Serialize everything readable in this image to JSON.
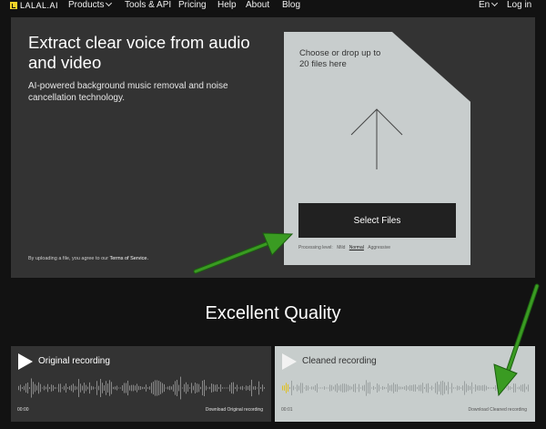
{
  "nav": {
    "logo_text": "LALAL.AI",
    "items": [
      {
        "label": "Products",
        "dropdown": true
      },
      {
        "label": "Tools & API"
      },
      {
        "label": "Pricing"
      },
      {
        "label": "Help"
      },
      {
        "label": "About"
      },
      {
        "label": "Blog"
      }
    ],
    "language": "En",
    "login": "Log in"
  },
  "hero": {
    "title": "Extract clear voice from audio and video",
    "subtitle": "AI-powered background music removal and noise cancellation technology.",
    "terms_prefix": "By uploading a file, you agree to our",
    "terms_link": "Terms of Service."
  },
  "dropzone": {
    "text": "Choose or drop up to 20 files here",
    "button": "Select Files",
    "level_label": "Processing level:",
    "levels": [
      "Mild",
      "Normal",
      "Aggressive"
    ],
    "selected_level": "Normal"
  },
  "quality": {
    "title": "Excellent Quality",
    "original": {
      "title": "Original recording",
      "time": "00:00",
      "download": "Download Original recording"
    },
    "cleaned": {
      "title": "Cleaned recording",
      "time": "00:01",
      "download": "Download Cleaned recording"
    }
  },
  "colors": {
    "background": "#121212",
    "panel": "#333333",
    "dropzone": "#c8cdcd",
    "brand_yellow": "#f3d428",
    "annotation_green": "#3a9b22"
  }
}
